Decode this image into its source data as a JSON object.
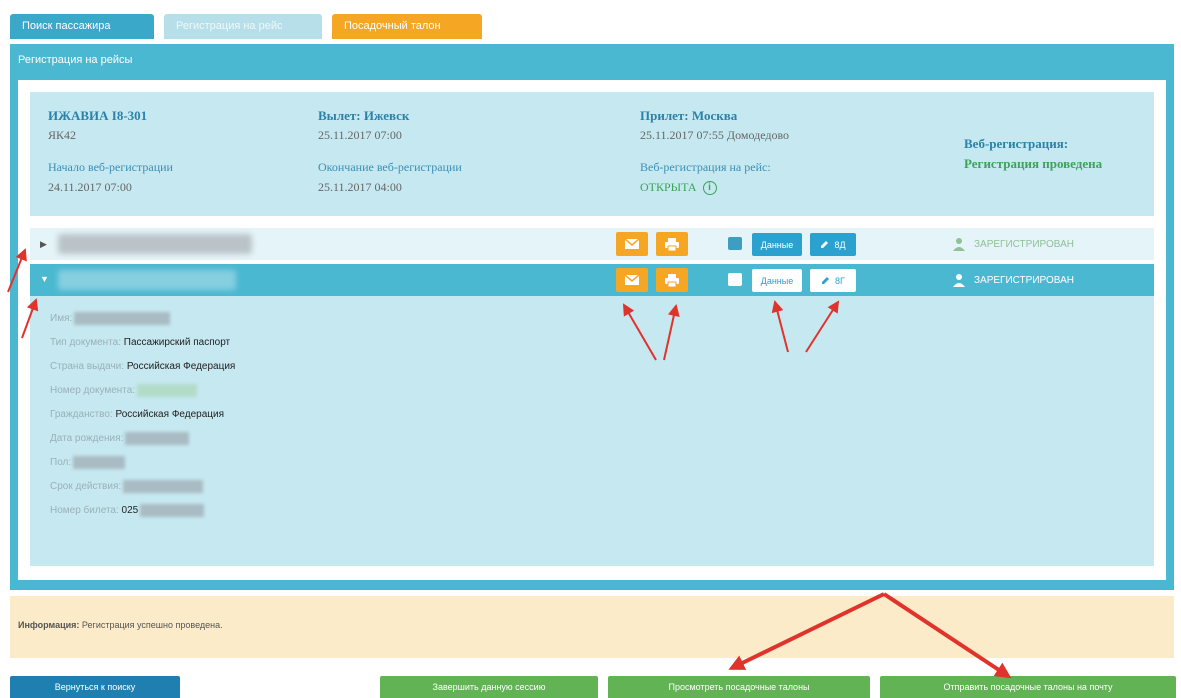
{
  "tabs": [
    {
      "label": "Поиск пассажира"
    },
    {
      "label": "Регистрация на рейс"
    },
    {
      "label": "Посадочный талон"
    }
  ],
  "panel": {
    "title": "Регистрация на рейсы"
  },
  "flight": {
    "number": "ИЖАВИА I8-301",
    "aircraft": "ЯК42",
    "departure_label": "Вылет: Ижевск",
    "departure_time": "25.11.2017 07:00",
    "arrival_label": "Прилет: Москва",
    "arrival_time": "25.11.2017 07:55 Домодедово",
    "webreg_start_label": "Начало веб-регистрации",
    "webreg_start": "24.11.2017 07:00",
    "webreg_end_label": "Окончание веб-регистрации",
    "webreg_end": "25.11.2017 04:00",
    "webreg_flight_label": "Веб-регистрация на рейс:",
    "webreg_flight_status": "ОТКРЫТА",
    "webreg_label": "Веб-регистрация:",
    "webreg_status": "Регистрация проведена"
  },
  "passengers": [
    {
      "data_label": "Данные",
      "seat_label": "8Д",
      "status": "ЗАРЕГИСТРИРОВАН"
    },
    {
      "data_label": "Данные",
      "seat_label": "8Г",
      "status": "ЗАРЕГИСТРИРОВАН"
    }
  ],
  "details": {
    "name_label": "Имя:",
    "doc_type_label": "Тип документа:",
    "doc_type": "Пассажирский паспорт",
    "country_label": "Страна выдачи:",
    "country": "Российская Федерация",
    "doc_number_label": "Номер документа:",
    "citizenship_label": "Гражданство:",
    "citizenship": "Российская Федерация",
    "birth_label": "Дата рождения:",
    "sex_label": "Пол:",
    "validity_label": "Срок действия:",
    "ticket_label": "Номер билета:",
    "ticket_prefix": "025"
  },
  "notice": {
    "label": "Информация:",
    "text": "Регистрация успешно проведена."
  },
  "buttons": {
    "back": "Вернуться к поиску",
    "finish": "Завершить данную сессию",
    "view": "Просмотреть посадочные талоны",
    "send": "Отправить посадочные талоны на почту"
  },
  "colors": {
    "accent": "#4bb8d1",
    "orange": "#f5a623",
    "green": "#62b354",
    "annotation": "#e0332c"
  }
}
